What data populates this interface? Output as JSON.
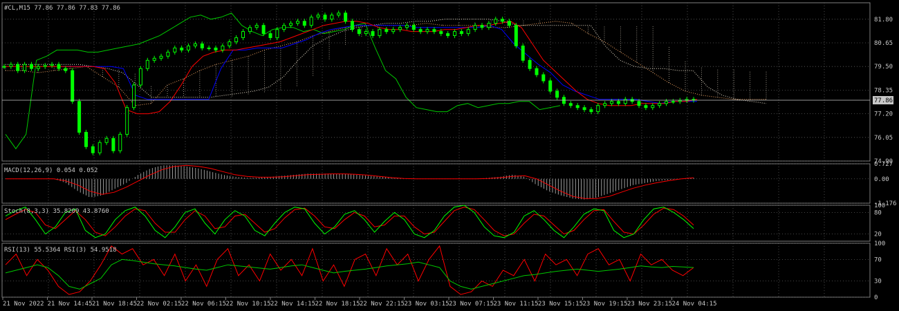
{
  "symbol_header": "#CL,M15  77.86 77.86 77.83 77.86",
  "current_price_label": "77.86",
  "colors": {
    "background": "#000000",
    "grid": "#606060",
    "frame": "#808080",
    "text": "#c8c8c8",
    "candle_up": "#00ff00",
    "candle_down": "#00ff00",
    "tenkan": "#ff0000",
    "kijun": "#0000ff",
    "chikou": "#00c800",
    "span_a": "#f4a460",
    "span_b": "#f0e6d2",
    "macd_hist": "#c0c0c0",
    "macd_signal": "#ff0000",
    "stoch_main": "#00ff00",
    "stoch_signal": "#ff0000",
    "rsi_13": "#00c800",
    "rsi_3": "#ff0000"
  },
  "chart_data": [
    {
      "type": "candlestick",
      "name": "price",
      "yticks": [
        "81.80",
        "80.65",
        "79.50",
        "78.35",
        "77.20",
        "76.05",
        "74.90"
      ],
      "ylim": [
        74.9,
        82.6
      ],
      "grid": true,
      "close_series": [
        79.5,
        79.6,
        79.3,
        79.6,
        79.4,
        79.5,
        79.55,
        79.6,
        79.4,
        79.3,
        77.8,
        76.3,
        75.6,
        75.3,
        75.8,
        76.0,
        75.4,
        76.2,
        77.5,
        78.6,
        79.4,
        79.8,
        79.9,
        80.0,
        80.2,
        80.4,
        80.3,
        80.5,
        80.6,
        80.4,
        80.4,
        80.3,
        80.5,
        80.7,
        80.9,
        81.2,
        81.4,
        81.5,
        81.1,
        80.9,
        81.3,
        81.5,
        81.6,
        81.7,
        81.5,
        81.9,
        82.0,
        81.8,
        82.0,
        82.1,
        81.7,
        81.3,
        81.1,
        81.2,
        81.0,
        81.3,
        81.2,
        81.3,
        81.4,
        81.5,
        81.3,
        81.2,
        81.3,
        81.2,
        81.1,
        81.0,
        81.2,
        81.1,
        81.3,
        81.5,
        81.4,
        81.6,
        81.8,
        81.7,
        81.5,
        80.5,
        79.8,
        79.4,
        79.1,
        78.8,
        78.3,
        78.0,
        77.7,
        77.6,
        77.5,
        77.4,
        77.3,
        77.6,
        77.7,
        77.8,
        77.7,
        77.9,
        77.8,
        77.6,
        77.5,
        77.6,
        77.7,
        77.8,
        77.8,
        77.85,
        77.9,
        77.86
      ],
      "tenkan_series": [
        79.5,
        79.5,
        79.5,
        79.5,
        79.5,
        79.5,
        79.5,
        79.5,
        79.5,
        79.4,
        78.7,
        77.4,
        77.2,
        77.2,
        77.3,
        77.8,
        78.6,
        79.5,
        80.0,
        80.2,
        80.3,
        80.3,
        80.4,
        80.5,
        80.6,
        80.7,
        80.9,
        81.1,
        81.3,
        81.5,
        81.6,
        81.7,
        81.7,
        81.6,
        81.4,
        81.3,
        81.3,
        81.2,
        81.2,
        81.2,
        81.3,
        81.3,
        81.4,
        81.5,
        81.5,
        81.6,
        81.7,
        81.4,
        80.6,
        79.8,
        79.3,
        78.8,
        78.3,
        77.9,
        77.7,
        77.6,
        77.6,
        77.6,
        77.7,
        77.7,
        77.7,
        77.8,
        77.8,
        77.9
      ],
      "kijun_series": [
        79.5,
        79.5,
        79.5,
        79.5,
        79.5,
        79.4,
        78.1,
        77.9,
        77.9,
        77.9,
        77.9,
        77.9,
        77.9,
        79.4,
        80.3,
        80.3,
        80.4,
        80.4,
        80.4,
        80.6,
        80.8,
        81.1,
        81.3,
        81.4,
        81.5,
        81.5,
        81.5,
        81.5,
        81.5,
        81.4,
        81.4,
        81.4,
        81.4,
        81.4,
        81.4,
        81.5,
        81.3,
        80.6,
        80.1,
        79.6,
        79.2,
        78.6,
        78.3,
        78.1,
        77.9,
        77.9,
        77.9,
        77.9,
        77.8,
        77.7,
        77.8,
        77.8,
        77.8
      ],
      "span_a_series": [
        79.3,
        79.3,
        79.2,
        79.3,
        79.4,
        79.5,
        79.0,
        78.5,
        77.6,
        77.7,
        78.6,
        78.9,
        79.3,
        79.6,
        79.8,
        80.0,
        80.3,
        80.5,
        80.7,
        81.0,
        81.2,
        81.4,
        81.5,
        81.5,
        81.5,
        81.5,
        81.6,
        81.5,
        81.5,
        81.5,
        81.4,
        81.4,
        81.5,
        81.6,
        81.7,
        81.6,
        81.1,
        80.7,
        80.2,
        79.7,
        79.2,
        78.7,
        78.3,
        78.1,
        78.0,
        77.9,
        77.9,
        77.9
      ],
      "span_b_series": [
        79.6,
        79.6,
        79.6,
        79.6,
        79.6,
        79.6,
        79.5,
        79.4,
        79.2,
        78.6,
        78.0,
        78.0,
        78.0,
        78.0,
        78.0,
        78.1,
        78.2,
        78.3,
        78.5,
        79.0,
        79.8,
        80.5,
        80.9,
        81.2,
        81.4,
        81.5,
        81.6,
        81.6,
        81.7,
        81.7,
        81.8,
        81.8,
        81.8,
        81.8,
        81.7,
        81.5,
        81.5,
        81.5,
        81.5,
        81.5,
        81.5,
        80.5,
        79.8,
        79.5,
        79.4,
        79.4,
        79.3,
        79.3,
        78.5,
        78.1,
        77.9,
        77.8,
        77.7
      ],
      "chikou_series": [
        76.2,
        75.5,
        76.2,
        79.8,
        80.0,
        80.3,
        80.3,
        80.3,
        80.2,
        80.2,
        80.3,
        80.4,
        80.5,
        80.6,
        80.8,
        81.0,
        81.3,
        81.6,
        81.9,
        82.0,
        81.8,
        81.9,
        82.1,
        81.5,
        81.2,
        81.0,
        81.3,
        81.4,
        81.4,
        81.2,
        81.3,
        81.1,
        81.2,
        81.3,
        81.5,
        81.6,
        80.4,
        79.3,
        78.9,
        78.0,
        77.5,
        77.4,
        77.3,
        77.3,
        77.6,
        77.7,
        77.5,
        77.6,
        77.7,
        77.7,
        77.8,
        77.8,
        77.4,
        77.5,
        77.6
      ]
    },
    {
      "type": "bar",
      "name": "MACD(12,26,9)",
      "header": "MACD(12,26,9) 0.054 0.052",
      "yticks": [
        "0.727",
        "0.00",
        "-1.176"
      ],
      "ylim": [
        -1.176,
        0.727
      ],
      "histogram": [
        0.0,
        0.0,
        0.0,
        0.0,
        0.0,
        -0.2,
        -0.6,
        -0.9,
        -0.8,
        -0.5,
        -0.2,
        0.2,
        0.5,
        0.65,
        0.65,
        0.6,
        0.5,
        0.35,
        0.2,
        0.1,
        0.05,
        0.05,
        0.1,
        0.15,
        0.2,
        0.25,
        0.25,
        0.25,
        0.25,
        0.2,
        0.15,
        0.1,
        0.05,
        0.0,
        0.0,
        0.0,
        0.0,
        0.0,
        0.0,
        0.0,
        0.05,
        0.1,
        0.2,
        0.1,
        -0.3,
        -0.6,
        -0.8,
        -0.95,
        -1.0,
        -0.9,
        -0.7,
        -0.5,
        -0.3,
        -0.2,
        -0.1,
        -0.05,
        0.0,
        0.05
      ],
      "signal": [
        0.0,
        0.0,
        0.0,
        0.0,
        0.0,
        -0.1,
        -0.3,
        -0.6,
        -0.75,
        -0.65,
        -0.4,
        -0.1,
        0.2,
        0.45,
        0.6,
        0.65,
        0.6,
        0.5,
        0.35,
        0.2,
        0.12,
        0.08,
        0.08,
        0.1,
        0.15,
        0.2,
        0.22,
        0.24,
        0.24,
        0.22,
        0.18,
        0.12,
        0.06,
        0.02,
        0.0,
        0.0,
        0.0,
        0.0,
        0.0,
        0.0,
        0.02,
        0.06,
        0.12,
        0.15,
        0.0,
        -0.3,
        -0.6,
        -0.85,
        -0.95,
        -0.95,
        -0.85,
        -0.65,
        -0.45,
        -0.3,
        -0.18,
        -0.08,
        0.0,
        0.05
      ]
    },
    {
      "type": "line",
      "name": "Stoch(8,3,3)",
      "header": "Stoch(8,3,3) 35.8209 43.8760",
      "yticks": [
        "100",
        "80",
        "20"
      ],
      "ylim": [
        0,
        100
      ],
      "main": [
        70,
        85,
        95,
        60,
        20,
        40,
        80,
        90,
        30,
        10,
        20,
        60,
        85,
        95,
        70,
        30,
        10,
        40,
        80,
        90,
        50,
        20,
        60,
        85,
        70,
        30,
        15,
        50,
        80,
        95,
        90,
        50,
        20,
        40,
        75,
        85,
        60,
        25,
        55,
        80,
        60,
        20,
        10,
        30,
        70,
        95,
        100,
        80,
        40,
        15,
        10,
        25,
        70,
        85,
        60,
        30,
        10,
        40,
        75,
        90,
        85,
        30,
        10,
        20,
        60,
        90,
        95,
        80,
        60,
        35
      ],
      "signal": [
        60,
        75,
        88,
        80,
        45,
        35,
        60,
        85,
        60,
        25,
        15,
        40,
        70,
        90,
        85,
        50,
        25,
        25,
        60,
        85,
        70,
        35,
        40,
        70,
        75,
        50,
        25,
        35,
        65,
        88,
        92,
        70,
        40,
        35,
        60,
        80,
        70,
        40,
        45,
        70,
        70,
        40,
        20,
        25,
        55,
        85,
        95,
        88,
        60,
        30,
        15,
        20,
        50,
        75,
        70,
        45,
        20,
        30,
        60,
        85,
        88,
        55,
        25,
        20,
        45,
        75,
        92,
        88,
        70,
        45
      ]
    },
    {
      "type": "line",
      "name": "RSI",
      "header": "RSI(13) 55.5364  RSI(3) 54.9518",
      "yticks": [
        "100",
        "70",
        "30",
        "0"
      ],
      "ylim": [
        0,
        100
      ],
      "series": [
        {
          "name": "RSI(13)",
          "values": [
            45,
            50,
            55,
            60,
            55,
            40,
            20,
            15,
            25,
            35,
            60,
            70,
            68,
            65,
            62,
            60,
            58,
            55,
            52,
            50,
            55,
            60,
            58,
            56,
            54,
            52,
            55,
            58,
            60,
            55,
            50,
            45,
            48,
            50,
            52,
            55,
            58,
            60,
            62,
            65,
            60,
            55,
            30,
            20,
            15,
            20,
            25,
            30,
            35,
            40,
            42,
            45,
            48,
            50,
            52,
            50,
            48,
            50,
            52,
            55,
            58,
            56,
            55,
            57,
            56,
            55
          ]
        },
        {
          "name": "RSI(3)",
          "values": [
            60,
            80,
            40,
            70,
            50,
            20,
            5,
            10,
            30,
            60,
            95,
            80,
            90,
            60,
            70,
            40,
            80,
            30,
            60,
            20,
            70,
            90,
            40,
            60,
            30,
            80,
            50,
            70,
            40,
            90,
            30,
            60,
            20,
            70,
            80,
            40,
            90,
            60,
            80,
            30,
            70,
            95,
            20,
            5,
            10,
            30,
            20,
            50,
            40,
            70,
            30,
            80,
            60,
            70,
            40,
            80,
            90,
            60,
            70,
            30,
            80,
            60,
            70,
            50,
            40,
            55
          ]
        }
      ]
    }
  ],
  "time_axis": [
    "21 Nov 2022",
    "21 Nov 14:45",
    "21 Nov 18:45",
    "22 Nov 02:15",
    "22 Nov 06:15",
    "22 Nov 10:15",
    "22 Nov 14:15",
    "22 Nov 18:15",
    "22 Nov 22:15",
    "23 Nov 03:15",
    "23 Nov 07:15",
    "23 Nov 11:15",
    "23 Nov 15:15",
    "23 Nov 19:15",
    "23 Nov 23:15",
    "24 Nov 04:15"
  ]
}
